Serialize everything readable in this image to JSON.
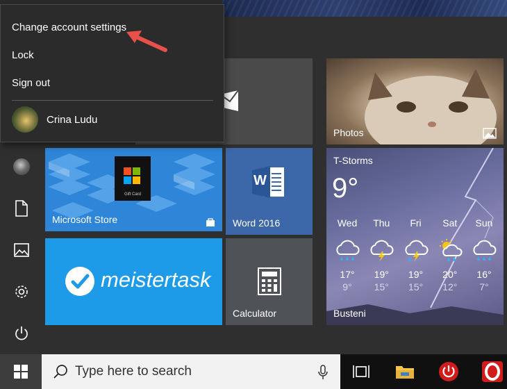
{
  "account_menu": {
    "items": [
      {
        "label": "Change account settings"
      },
      {
        "label": "Lock"
      },
      {
        "label": "Sign out"
      }
    ],
    "user_name": "Crina Ludu"
  },
  "tiles": {
    "photos": "Photos",
    "store": "Microsoft Store",
    "word": "Word 2016",
    "meistertask": "meistertask",
    "calculator": "Calculator",
    "store_card": "Gift Card",
    "word_letter": "W"
  },
  "weather": {
    "condition": "T-Storms",
    "temp": "9°",
    "location": "Busteni",
    "days": [
      {
        "name": "Wed",
        "hi": "17°",
        "lo": "9°",
        "icon": "rain-cloud-icon"
      },
      {
        "name": "Thu",
        "hi": "19°",
        "lo": "15°",
        "icon": "thunderstorm-icon"
      },
      {
        "name": "Fri",
        "hi": "19°",
        "lo": "15°",
        "icon": "thunderstorm-icon"
      },
      {
        "name": "Sat",
        "hi": "20°",
        "lo": "12°",
        "icon": "sun-rain-icon"
      },
      {
        "name": "Sun",
        "hi": "16°",
        "lo": "7°",
        "icon": "rain-cloud-icon"
      }
    ]
  },
  "taskbar": {
    "search_placeholder": "Type here to search"
  },
  "colors": {
    "accent_red_arrow": "#e8504a",
    "store_blue": "#2f86d8",
    "word_blue": "#3c67a8",
    "meister_blue": "#1e9be8",
    "opera_red": "#d21b1b"
  }
}
